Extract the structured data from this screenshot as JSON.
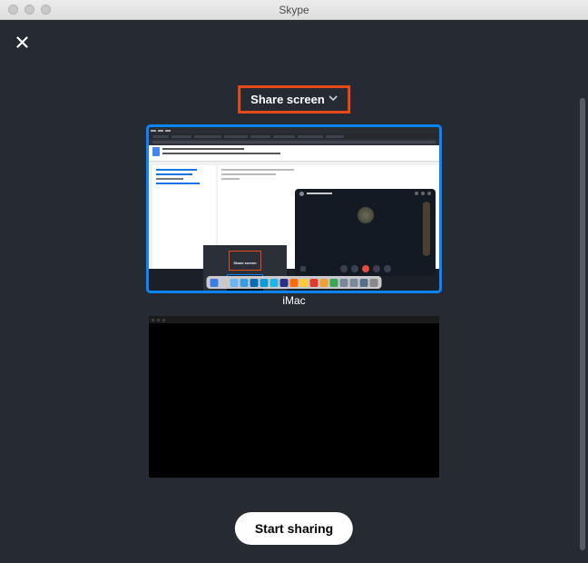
{
  "window": {
    "title": "Skype"
  },
  "dropdown": {
    "label": "Share screen"
  },
  "screens": [
    {
      "label": "iMac",
      "selected": true
    },
    {
      "label": "",
      "selected": false
    }
  ],
  "action": {
    "start_label": "Start sharing"
  },
  "thumb1": {
    "call_name": "Fancy Citizen",
    "dock_colors": [
      "#3b7de0",
      "#c8c8c8",
      "#6fb4f2",
      "#3a9de0",
      "#0a6bb5",
      "#129ad6",
      "#1fb6e6",
      "#2c2f84",
      "#ff6a00",
      "#ffcc33",
      "#e23a2e",
      "#f0a030",
      "#3aa655",
      "#7a889a",
      "#7a889a",
      "#547089",
      "#888888"
    ]
  }
}
